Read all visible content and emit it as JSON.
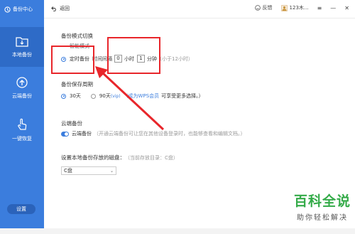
{
  "sidebar": {
    "brand": "备份中心",
    "items": [
      {
        "label": "本地备份",
        "icon": "folder-icon"
      },
      {
        "label": "云端备份",
        "icon": "cloud-upload-icon"
      },
      {
        "label": "一键恢复",
        "icon": "hand-pointer-icon"
      }
    ],
    "settings_label": "设置"
  },
  "topbar": {
    "back_label": "返回",
    "feedback_label": "反馈",
    "user_label": "123木...",
    "icons": [
      "smile-icon",
      "avatar-icon",
      "menu-icon",
      "minimize-icon",
      "close-icon"
    ]
  },
  "backup_mode": {
    "title": "备份模式切换",
    "smart_label": "智能模式",
    "timed_label": "定时备份",
    "interval_label": "时间间隔",
    "hours_value": "0",
    "hours_unit": "小时",
    "minutes_value": "1",
    "minutes_unit": "分钟",
    "hint": "（小于12小时）"
  },
  "retention": {
    "title": "备份保存周期",
    "option_30": "30天",
    "option_90": "90天",
    "vip_tag": "(vip)",
    "link": "（成为WPS会员",
    "link_suffix": "可享受更多选择。）"
  },
  "cloud": {
    "title": "云端备份",
    "toggle_label": "云端备份",
    "desc": "（开通云端备份可让您在其他设备登录时，也能够查看和编辑文档。）"
  },
  "disk": {
    "title": "设置本地备份存放的磁盘：",
    "current": "（当前存放目录：C盘）",
    "selected": "C盘"
  },
  "watermark": {
    "title": "百科全说",
    "subtitle": "助你轻松解决"
  },
  "colors": {
    "sidebar": "#3b7ddd",
    "accent": "#3b7ddd",
    "annotation": "#e8262b",
    "watermark": "#34ab49"
  }
}
